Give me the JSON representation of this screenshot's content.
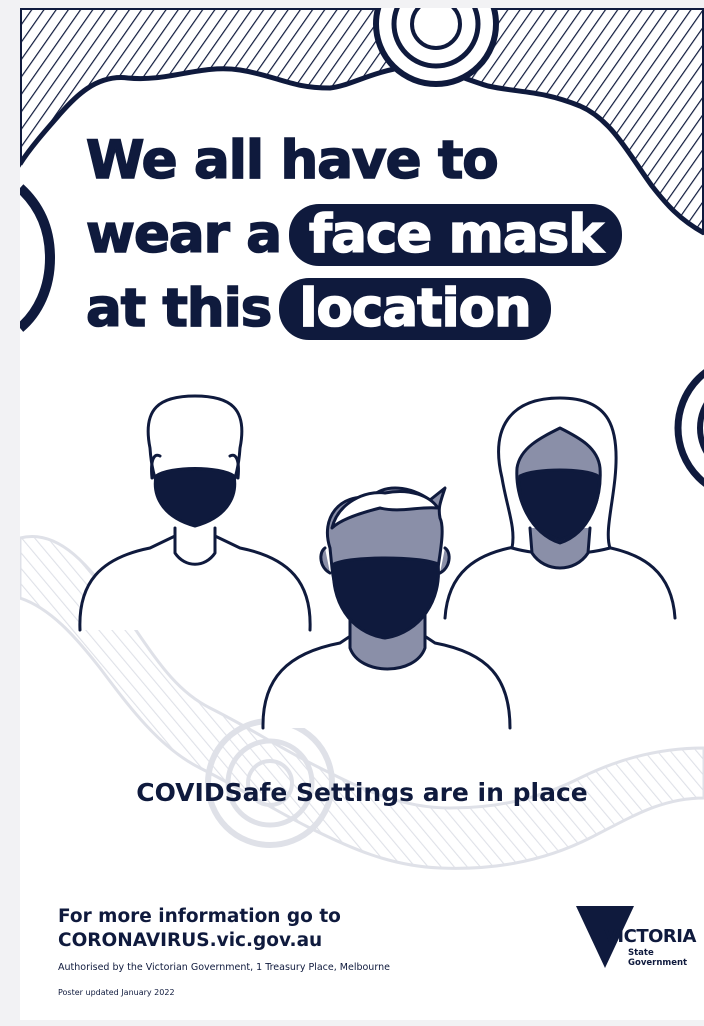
{
  "headline": {
    "line1": "We all have to",
    "line2_prefix": "wear a",
    "line2_highlight": "face mask",
    "line3_prefix": "at this",
    "line3_highlight": "location"
  },
  "subheading": "COVIDSafe Settings are in place",
  "footer": {
    "info_line1": "For more information go to",
    "info_line2": "CORONAVIRUS.vic.gov.au",
    "authorised": "Authorised by the Victorian Government, 1 Treasury Place, Melbourne",
    "updated": "Poster updated January 2022"
  },
  "logo": {
    "word": "VICTORIA",
    "line1": "State",
    "line2": "Government"
  },
  "colors": {
    "navy": "#0f1a3d",
    "grey_fill": "#8a8fa8",
    "light_pattern": "#dfe1e8"
  }
}
